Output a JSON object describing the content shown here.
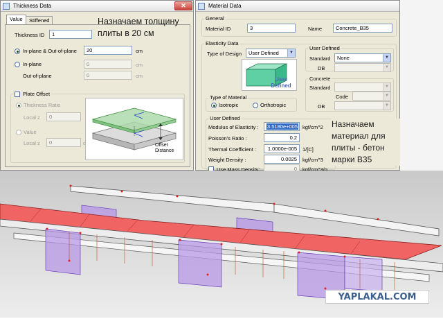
{
  "thickness_window": {
    "title": "Thickness Data",
    "tabs": [
      {
        "label": "Value"
      },
      {
        "label": "Stiffened"
      }
    ],
    "thickness_id_label": "Thickness ID",
    "thickness_id": "1",
    "inplane_out_label": "In-plane & Out-of-plane",
    "inplane_out_value": "20",
    "unit_cm": "cm",
    "inplane_label": "In-plane",
    "inplane_value": "0",
    "outplane_label": "Out-of-plane",
    "outplane_value": "0",
    "plate_offset_label": "Plate Offset",
    "thickness_ratio_label": "Thickness Ratio",
    "local_z_label": "Local z",
    "local_z_ratio": "0",
    "value_label": "Value",
    "local_z_value": "0",
    "unit_cm2": "cm",
    "diagram_offset_label": "Offset Distance",
    "annotation": "Назначаем толщину плиты в 20 см"
  },
  "material_window": {
    "title": "Material Data",
    "general_title": "General",
    "material_id_label": "Material ID",
    "material_id": "3",
    "name_label": "Name",
    "name_value": "Concrete_B35",
    "elasticity_title": "Elasticity Data",
    "type_of_design_label": "Type of Design",
    "type_of_design_value": "User Defined",
    "image_caption": "User Defined",
    "user_defined_title": "User Defined",
    "standard_label": "Standard",
    "standard_value": "None",
    "db_label": "DB",
    "concrete_title": "Concrete",
    "code_label": "Code",
    "type_of_material_title": "Type of Material",
    "isotropic_label": "Isotropic",
    "orthotropic_label": "Orthotropic",
    "props_title": "User Defined",
    "modulus_label": "Modulus of Elasticity :",
    "modulus_value": "3.5180e+005",
    "modulus_unit": "kgf/cm^2",
    "poisson_label": "Poisson's Ratio :",
    "poisson_value": "0.2",
    "thermal_label": "Thermal Coefficient :",
    "thermal_value": "1.0000e-005",
    "thermal_unit": "1/[C]",
    "weight_label": "Weight Density :",
    "weight_value": "0.0025",
    "weight_unit": "kgf/cm^3",
    "mass_label": "Use Mass Density:",
    "mass_value": "0",
    "mass_unit": "kgf/cm^3/g",
    "annotation": "Назначаем материал для плиты - бетон марки В35"
  },
  "watermark": "YAPLAKAL.COM",
  "close_glyph": "✕"
}
